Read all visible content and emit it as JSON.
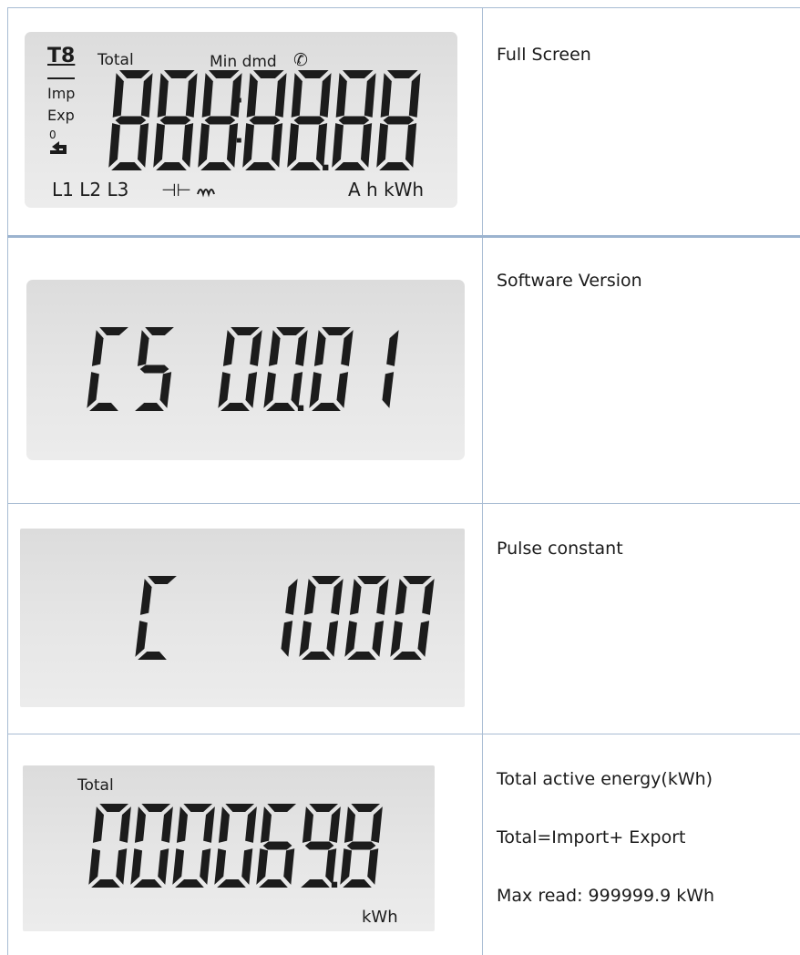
{
  "rows": [
    {
      "description": [
        "Full Screen"
      ],
      "display": {
        "tariff": "T8",
        "total": "Total",
        "min_dmd": "Min dmd",
        "imp": "Imp",
        "exp": "Exp",
        "reset": "0",
        "phases": "L1 L2 L3",
        "units": "A h kWh",
        "digits": "888:88.88"
      }
    },
    {
      "description": [
        "Software Version"
      ],
      "display": {
        "digits": "CS 00.01"
      }
    },
    {
      "description": [
        "Pulse constant"
      ],
      "display": {
        "digits": "C 1000"
      }
    },
    {
      "description": [
        "Total active energy(kWh)",
        "Total=Import+ Export",
        "Max read: 999999.9 kWh"
      ],
      "display": {
        "label": "Total",
        "digits": "000069.8",
        "unit": "kWh"
      }
    }
  ],
  "colors": {
    "border": "#a8bcd3",
    "lcd_bg": "#e2e2e2",
    "segment": "#1c1c1c"
  }
}
